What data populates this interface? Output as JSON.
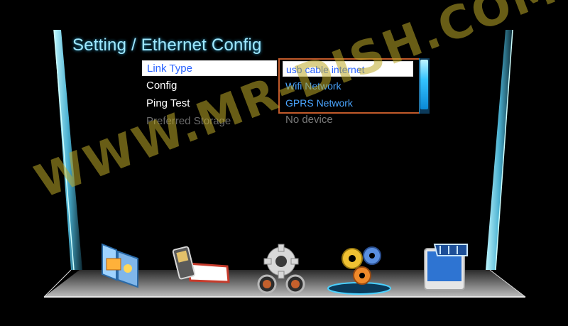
{
  "window": {
    "title": "Setting / Ethernet Config"
  },
  "menu": {
    "items": [
      {
        "label": "Link Type"
      },
      {
        "label": "Config"
      },
      {
        "label": "Ping Test"
      },
      {
        "label": "Preferred Storage"
      }
    ],
    "preferred_storage_value": "No device"
  },
  "dropdown": {
    "options": [
      {
        "label": "usb cable internet"
      },
      {
        "label": "Wifi Network"
      },
      {
        "label": "GPRS Network"
      }
    ],
    "selected_index": 0
  },
  "watermark": {
    "text": "WWW.MR-DISH.COM"
  },
  "dock": {
    "icons": [
      {
        "name": "media-gallery-icon"
      },
      {
        "name": "phone-device-icon"
      },
      {
        "name": "settings-gear-icon"
      },
      {
        "name": "system-settings-gears-icon"
      },
      {
        "name": "video-player-icon"
      }
    ],
    "selected_index": 3
  },
  "colors": {
    "title": "#9fe8ff",
    "selection_text": "#2a63ff",
    "option_text": "#4aa5ff",
    "dropdown_border": "#c25a2a",
    "watermark": "#bea228"
  }
}
